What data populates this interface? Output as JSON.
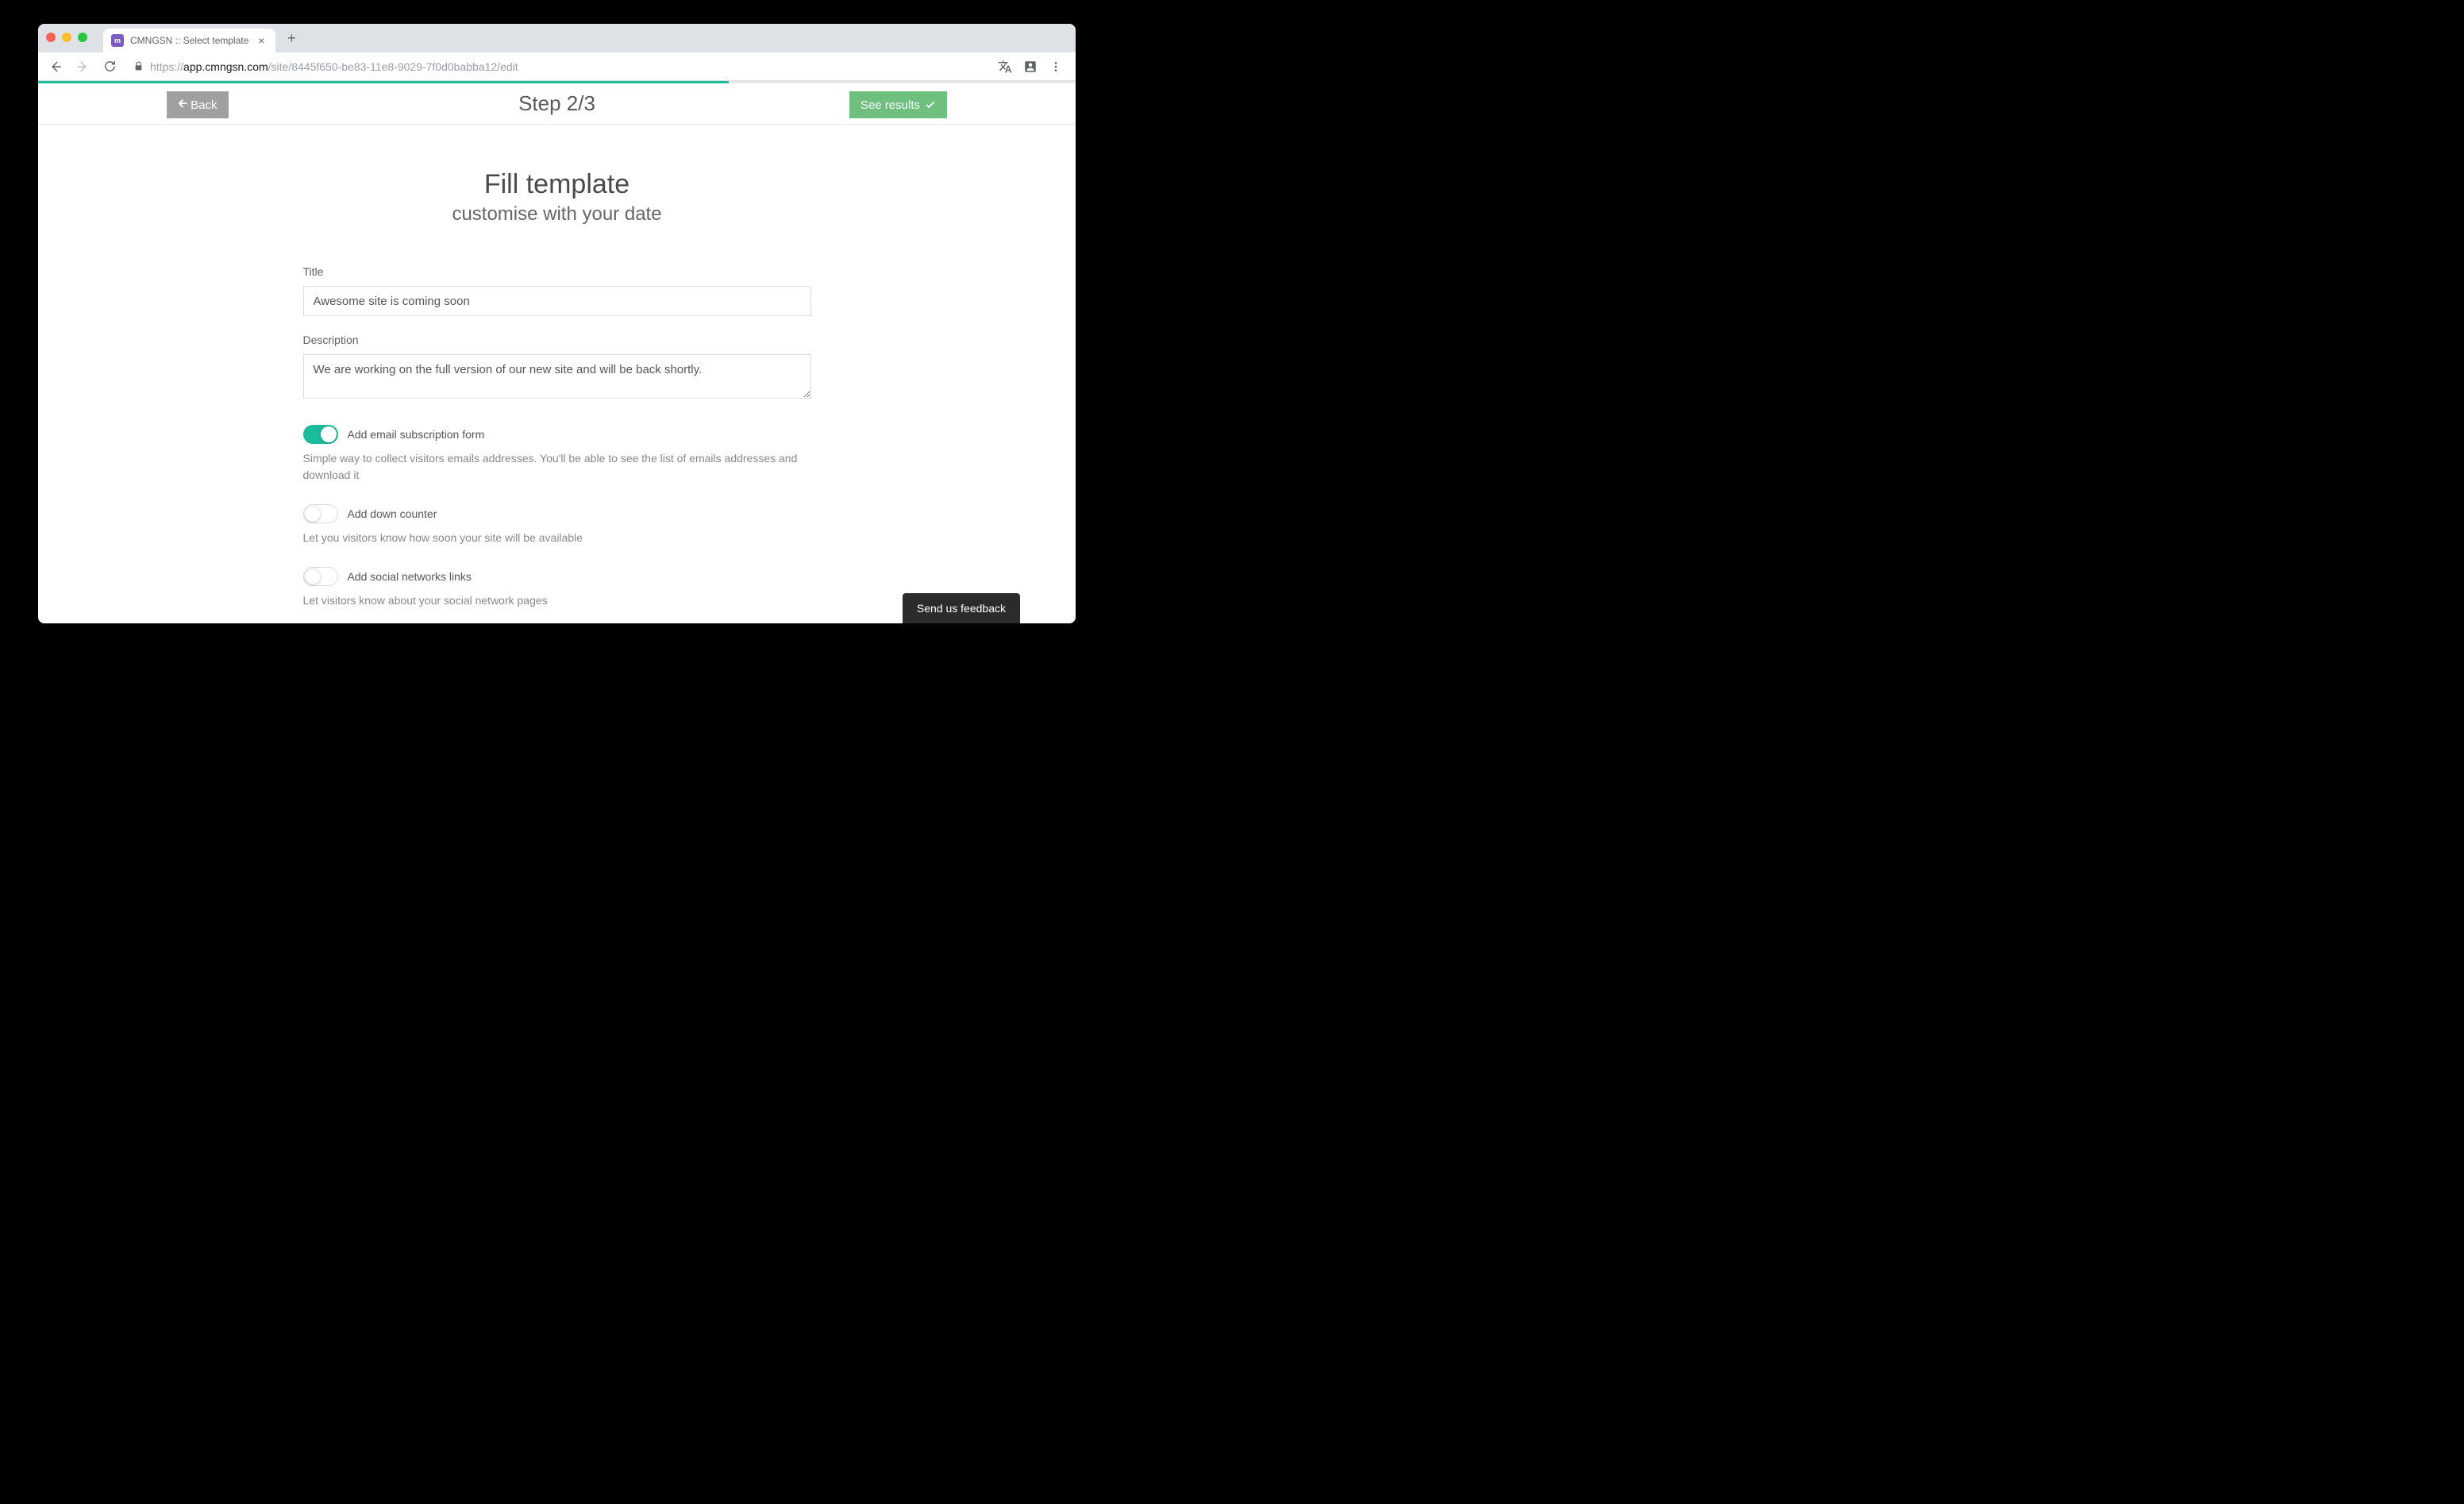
{
  "browser": {
    "tab": {
      "title": "CMNGSN :: Select template",
      "favicon_label": "m"
    },
    "url_prefix": "https://",
    "url_host": "app.cmngsn.com",
    "url_path": "/site/8445f650-be83-11e8-9029-7f0d0babba12/edit"
  },
  "progress": {
    "percent": 66.6
  },
  "step_bar": {
    "back_label": "Back",
    "title": "Step 2/3",
    "results_label": "See results"
  },
  "headings": {
    "main": "Fill template",
    "sub": "customise with your date"
  },
  "form": {
    "title_label": "Title",
    "title_value": "Awesome site is coming soon",
    "description_label": "Description",
    "description_value": "We are working on the full version of our new site and will be back shortly.",
    "toggles": [
      {
        "label": "Add email subscription form",
        "help": "Simple way to collect visitors emails addresses. You'll be able to see the list of emails addresses and download it",
        "on": true
      },
      {
        "label": "Add down counter",
        "help": "Let you visitors know how soon your site will be available",
        "on": false
      },
      {
        "label": "Add social networks links",
        "help": "Let visitors know about your social network pages",
        "on": false
      }
    ]
  },
  "feedback": {
    "label": "Send us feedback"
  }
}
